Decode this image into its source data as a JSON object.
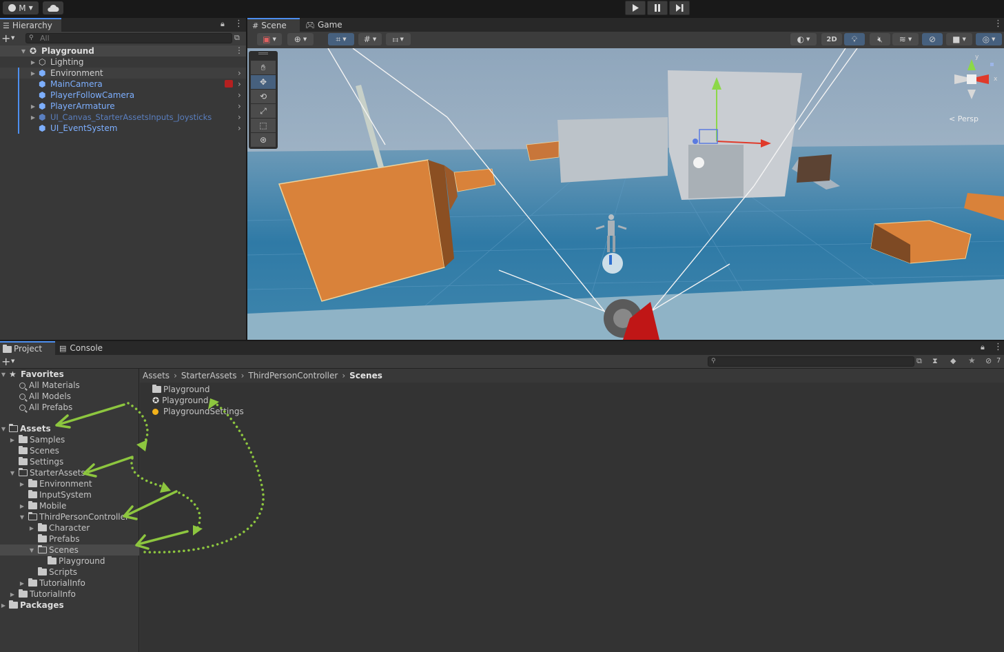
{
  "topbar": {
    "account_label": "M",
    "cloud_icon": "cloud-icon"
  },
  "hierarchy": {
    "tab_label": "Hierarchy",
    "search_placeholder": "All",
    "scene_name": "Playground",
    "items": [
      {
        "label": "Lighting"
      },
      {
        "label": "Environment"
      },
      {
        "label": "MainCamera"
      },
      {
        "label": "PlayerFollowCamera"
      },
      {
        "label": "PlayerArmature"
      },
      {
        "label": "UI_Canvas_StarterAssetsInputs_Joysticks"
      },
      {
        "label": "UI_EventSystem"
      }
    ]
  },
  "scene": {
    "tab_scene": "Scene",
    "tab_game": "Game",
    "btn_2d": "2D",
    "persp_label": "< Persp",
    "gizmo_y": "y",
    "gizmo_x": "x"
  },
  "project": {
    "tab_project": "Project",
    "tab_console": "Console",
    "hidden_count": "7",
    "breadcrumb": [
      "Assets",
      "StarterAssets",
      "ThirdPersonController",
      "Scenes"
    ],
    "favorites_label": "Favorites",
    "favorites": [
      "All Materials",
      "All Models",
      "All Prefabs"
    ],
    "assets_label": "Assets",
    "tree": [
      {
        "label": "Samples"
      },
      {
        "label": "Scenes"
      },
      {
        "label": "Settings"
      },
      {
        "label": "StarterAssets"
      },
      {
        "label": "Environment"
      },
      {
        "label": "InputSystem"
      },
      {
        "label": "Mobile"
      },
      {
        "label": "ThirdPersonController"
      },
      {
        "label": "Character"
      },
      {
        "label": "Prefabs"
      },
      {
        "label": "Scenes"
      },
      {
        "label": "Playground"
      },
      {
        "label": "Scripts"
      },
      {
        "label": "TutorialInfo"
      },
      {
        "label": "TutorialInfo"
      },
      {
        "label": "Packages"
      }
    ],
    "files": [
      {
        "label": "Playground"
      },
      {
        "label": "Playground"
      },
      {
        "label": "PlaygroundSettings"
      }
    ]
  },
  "colors": {
    "accent": "#4d8ff0",
    "prefab_blue": "#7dafff",
    "annotation_green": "#8dc63f"
  }
}
